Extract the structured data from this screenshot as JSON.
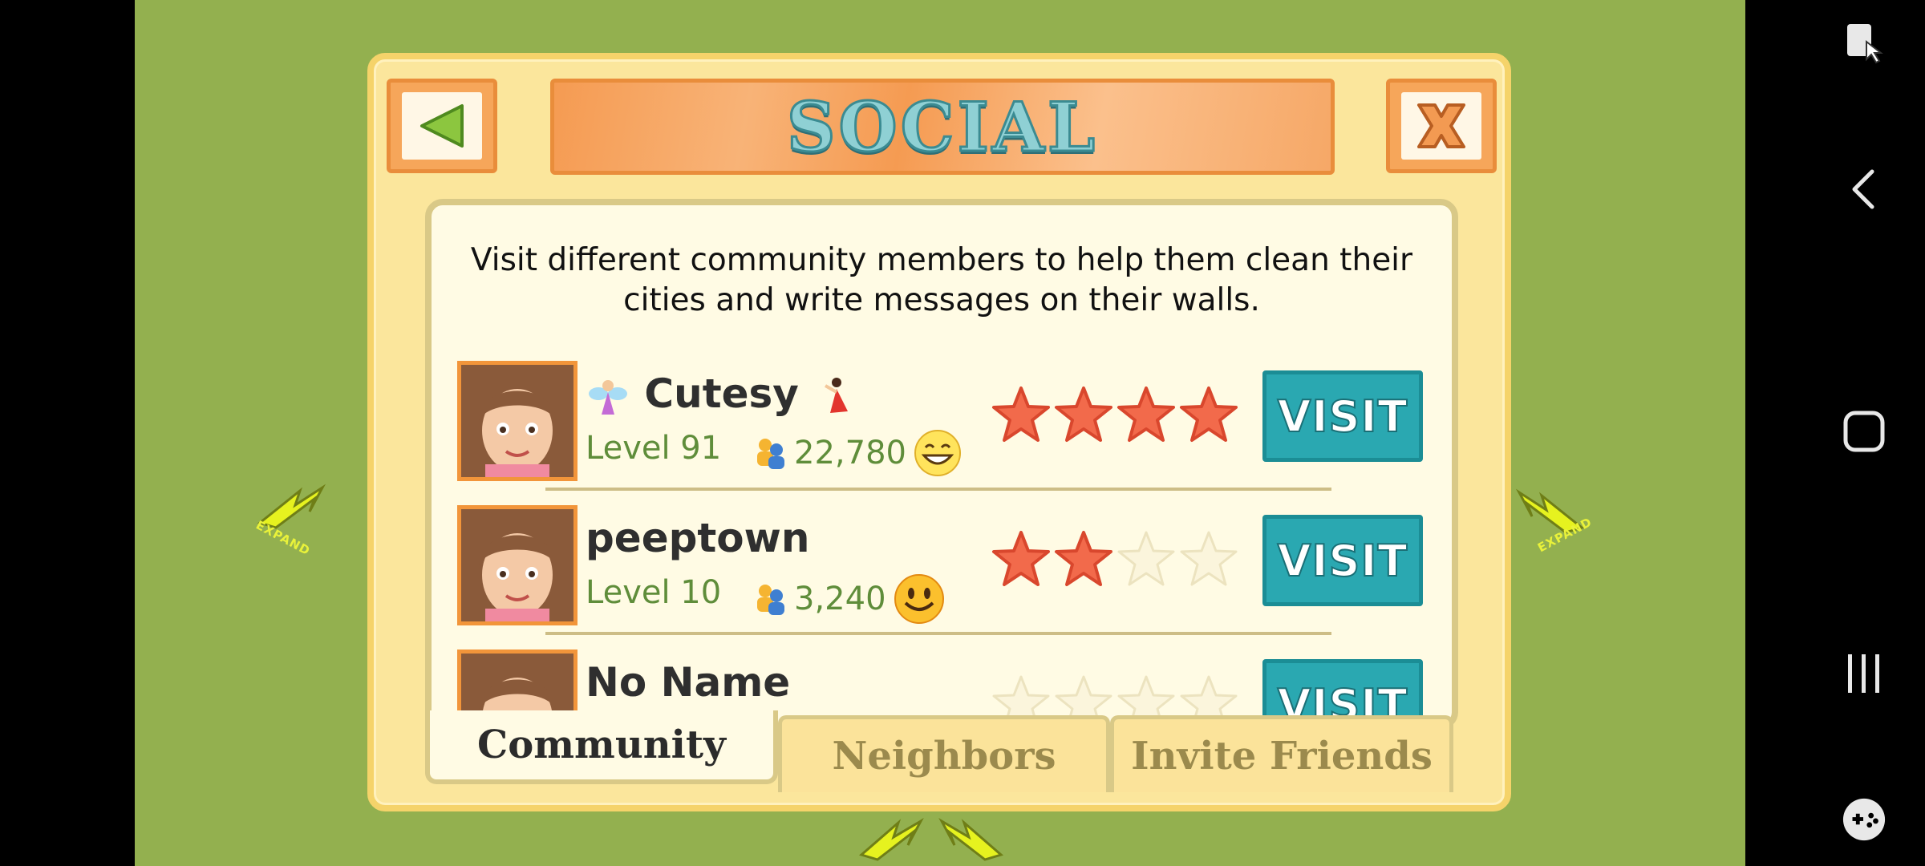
{
  "dialog": {
    "title": "SOCIAL",
    "intro": "Visit different community members to help them clean their cities and write messages on their walls."
  },
  "members": [
    {
      "name": "Cutesy",
      "level": "Level 91",
      "friends": "22,780",
      "stars": 4,
      "visit": "VISIT"
    },
    {
      "name": "peeptown",
      "level": "Level 10",
      "friends": "3,240",
      "stars": 2,
      "visit": "VISIT"
    },
    {
      "name": "No Name",
      "level": "",
      "friends": "",
      "stars": 0,
      "visit": "VISIT"
    }
  ],
  "tabs": [
    "Community",
    "Neighbors",
    "Invite Friends"
  ],
  "map": {
    "expand_label": "EXPAND"
  },
  "icons": {
    "back": "back-arrow-icon",
    "close": "close-icon",
    "friends": "friends-icon",
    "system": [
      "screenshot-icon",
      "back-nav-icon",
      "home-icon",
      "recents-icon",
      "game-tools-icon"
    ]
  }
}
